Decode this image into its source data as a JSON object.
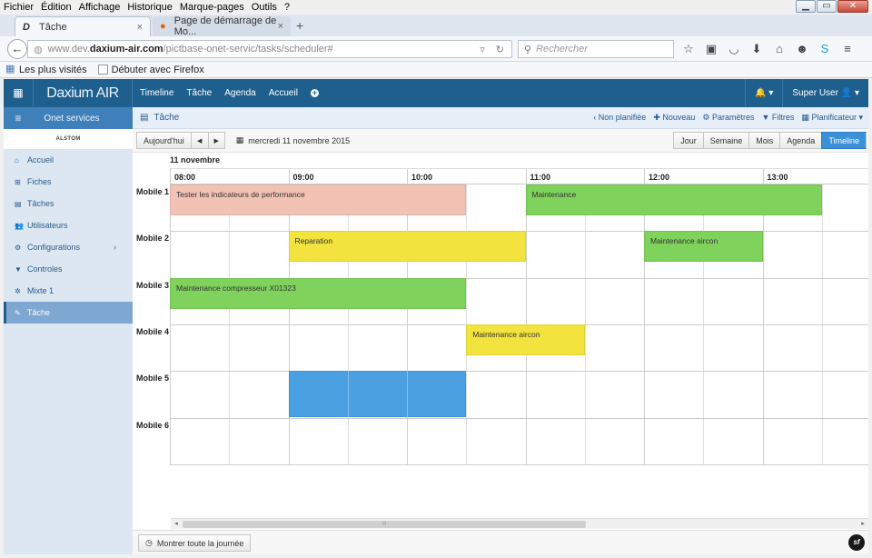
{
  "browser": {
    "menu": [
      "Fichier",
      "Édition",
      "Affichage",
      "Historique",
      "Marque-pages",
      "Outils",
      "?"
    ],
    "tabs": [
      {
        "label": "Tâche",
        "active": true
      },
      {
        "label": "Page de démarrage de Mo...",
        "active": false
      }
    ],
    "url_prefix": "www.dev.",
    "url_domain": "daxium-air.com",
    "url_path": "/pictbase-onet-servic/tasks/scheduler#",
    "search_placeholder": "Rechercher",
    "bookmarks": [
      "Les plus visités",
      "Débuter avec Firefox"
    ]
  },
  "app": {
    "brand": "Daxium AIR",
    "topnav": [
      "Timeline",
      "Tâche",
      "Agenda",
      "Accueil"
    ],
    "user": "Super User",
    "colors": {
      "primary": "#1e5f8e",
      "sidebar_head": "#3f80bb",
      "active_view": "#3b91d9"
    }
  },
  "sidebar": {
    "header": "Onet services",
    "logo_text": "ALSTOM",
    "items": [
      {
        "label": "Accueil",
        "icon": "home-icon",
        "glyph": "⌂"
      },
      {
        "label": "Fiches",
        "icon": "sitemap-icon",
        "glyph": "⊞"
      },
      {
        "label": "Tâches",
        "icon": "tasks-icon",
        "glyph": "▤"
      },
      {
        "label": "Utilisateurs",
        "icon": "users-icon",
        "glyph": "👥"
      },
      {
        "label": "Configurations",
        "icon": "cogs-icon",
        "glyph": "⚙"
      },
      {
        "label": "Controles",
        "icon": "filter-icon",
        "glyph": "▼"
      },
      {
        "label": "Mixte 1",
        "icon": "gear-icon",
        "glyph": "✲"
      },
      {
        "label": "Tâche",
        "icon": "wrench-icon",
        "glyph": "✎"
      }
    ]
  },
  "page": {
    "title": "Tâche",
    "actions": [
      "Non planifiée",
      "Nouveau",
      "Paramètres",
      "Filtres",
      "Planificateur"
    ],
    "today_label": "Aujourd'hui",
    "current_date": "mercredi 11 novembre 2015",
    "views": [
      "Jour",
      "Semaine",
      "Mois",
      "Agenda",
      "Timeline"
    ],
    "active_view": "Timeline",
    "show_all_day": "Montrer toute la journée"
  },
  "scheduler": {
    "date_header": "11 novembre",
    "hours": [
      "08:00",
      "09:00",
      "10:00",
      "11:00",
      "12:00",
      "13:00"
    ],
    "rows": [
      "Mobile 1",
      "Mobile 2",
      "Mobile 3",
      "Mobile 4",
      "Mobile 5",
      "Mobile 6"
    ],
    "events": [
      {
        "row": 0,
        "start": "08:00",
        "end": "10:30",
        "title": "Tester les indicateurs de performance",
        "color": "#f2c2b5"
      },
      {
        "row": 0,
        "start": "11:00",
        "end": "13:30",
        "title": "Maintenance",
        "color": "#7fd25c"
      },
      {
        "row": 1,
        "start": "09:00",
        "end": "11:00",
        "title": "Reparation",
        "color": "#f2e33e"
      },
      {
        "row": 1,
        "start": "12:00",
        "end": "13:00",
        "title": "Maintenance aircon",
        "color": "#7fd25c"
      },
      {
        "row": 2,
        "start": "08:00",
        "end": "10:30",
        "title": "Maintenance compresseur X01323",
        "color": "#7fd25c"
      },
      {
        "row": 3,
        "start": "10:30",
        "end": "11:30",
        "title": "Maintenance aircon",
        "color": "#f2e33e"
      },
      {
        "row": 4,
        "start": "09:00",
        "end": "10:30",
        "title": "",
        "color": "#4aa0e0"
      }
    ]
  }
}
